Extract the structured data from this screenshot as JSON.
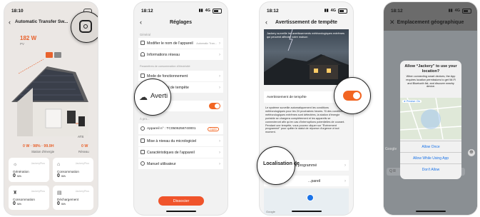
{
  "screen1": {
    "time": "18:10",
    "title": "Automatic Transfer Sw...",
    "pv_value": "182 W",
    "pv_label": "PV",
    "ats_label": "ATS",
    "station_value": "0 W · 98% · 99.9H",
    "station_label": "Station d'énergie",
    "reseau_value": "0 W",
    "reseau_label": "Réseau",
    "cards": [
      {
        "label": "Génération",
        "value": "0",
        "unit": "Wh",
        "brand": "JackeryPlus"
      },
      {
        "label": "Consommation",
        "value": "0",
        "unit": "Wh",
        "brand": "JackeryPlus"
      },
      {
        "label": "Consommation",
        "value": "0",
        "unit": "Wh",
        "brand": "JackeryPlus"
      },
      {
        "label": "Déchargement",
        "value": "0",
        "unit": "Wh",
        "brand": "JackeryPlus"
      }
    ]
  },
  "screen2": {
    "time": "18:12",
    "network": "4G",
    "title": "Réglages",
    "section_general": "Général",
    "rename": "Modifier le nom de l'appareil",
    "rename_value": "Automatic Tran...",
    "network_info": "Informations réseau",
    "section_params": "Paramètres de consommation d'électricité",
    "mode": "Mode de fonctionnement",
    "alert_partial": "...l de tempête",
    "magnifier_text": "Averti",
    "section_about": "À pro...",
    "device_no": "Appareil n° : TC0506258740001",
    "device_badge": "Copier",
    "firmware": "Mise à niveau du micrologiciel",
    "specs": "Caractéristiques de l'appareil",
    "manual": "Manuel utilisateur",
    "dissociate": "Dissocier"
  },
  "screen3": {
    "time": "18:12",
    "network": "4G",
    "title": "Avertissement de tempête",
    "banner_text": "Jackery surveille les avertissements météorologiques extrêmes qui peuvent affecter votre maison",
    "toggle_label": "Avertissement de tempête",
    "description": "Le système surveille automatiquement les conditions météorologiques pour les 24 prochaines heures. Si des conditions météorologiques extrêmes sont détectées, la station d'énergie portable se chargera complètement et les appareils se connecteront afin qu'en cas d'interruptions potentielles de courant. Pendant une tempête, vous pouvez cliquer sur \"Événement programmé\" pour quitter le statut de réponse d'urgence à tout moment.",
    "event": "Événement programmé",
    "appareil_partial": "...pareil",
    "magnifier_text": "Localisation de",
    "map_logo": "Google"
  },
  "screen4": {
    "time": "18:12",
    "network": "4G",
    "title": "Emplacement géographique",
    "dialog_title": "Allow “Jackery” to use your location?",
    "dialog_body": "When connecting smart devices, the App requires location permissions to get Wi-Fi and Bluetooth list, and discover nearby device.",
    "precise": "Precise: On",
    "allow_once": "Allow Once",
    "allow_while": "Allow While Using App",
    "dont_allow": "Don't Allow",
    "map_logo": "Google",
    "search_placeholder": "Q R"
  }
}
